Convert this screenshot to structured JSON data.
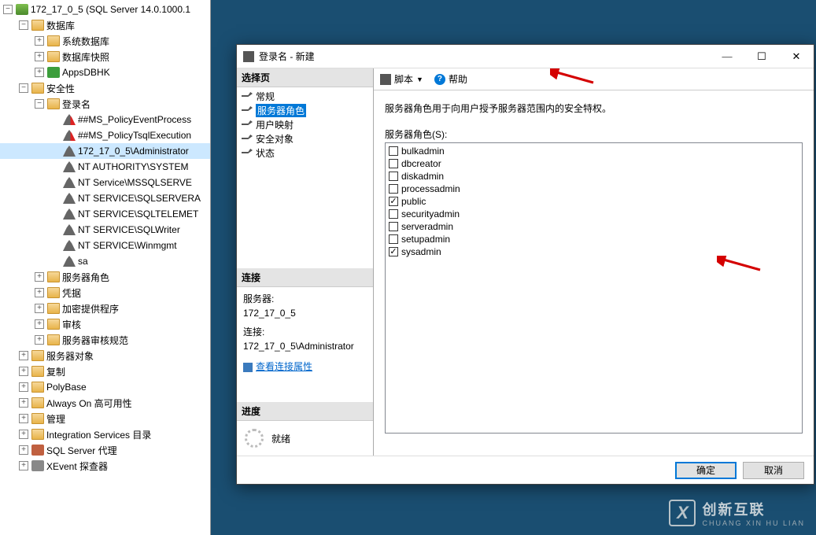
{
  "tree": {
    "server": "172_17_0_5 (SQL Server 14.0.1000.1",
    "db": "数据库",
    "sysdb": "系统数据库",
    "dbsnap": "数据库快照",
    "appsdb": "AppsDBHK",
    "security": "安全性",
    "logins": "登录名",
    "l1": "##MS_PolicyEventProcess",
    "l2": "##MS_PolicyTsqlExecution",
    "l3": "172_17_0_5\\Administrator",
    "l4": "NT AUTHORITY\\SYSTEM",
    "l5": "NT Service\\MSSQLSERVE",
    "l6": "NT SERVICE\\SQLSERVERA",
    "l7": "NT SERVICE\\SQLTELEMET",
    "l8": "NT SERVICE\\SQLWriter",
    "l9": "NT SERVICE\\Winmgmt",
    "l10": "sa",
    "srvroles": "服务器角色",
    "creds": "凭据",
    "crypto": "加密提供程序",
    "audit": "审核",
    "auditspec": "服务器审核规范",
    "srvobj": "服务器对象",
    "repl": "复制",
    "polybase": "PolyBase",
    "alwayson": "Always On 高可用性",
    "mgmt": "管理",
    "iscat": "Integration Services 目录",
    "agent": "SQL Server 代理",
    "xevent": "XEvent 探查器"
  },
  "dialog": {
    "title": "登录名 - 新建",
    "selectpage": "选择页",
    "pages": {
      "general": "常规",
      "serverroles": "服务器角色",
      "usermap": "用户映射",
      "securables": "安全对象",
      "status": "状态"
    },
    "connection_hdr": "连接",
    "server_lbl": "服务器:",
    "server_val": "172_17_0_5",
    "conn_lbl": "连接:",
    "conn_val": "172_17_0_5\\Administrator",
    "viewprops": "查看连接属性",
    "progress_hdr": "进度",
    "ready": "就绪",
    "script": "脚本",
    "help": "帮助",
    "desc": "服务器角色用于向用户授予服务器范围内的安全特权。",
    "roles_label": "服务器角色(S):",
    "roles": [
      {
        "name": "bulkadmin",
        "checked": false
      },
      {
        "name": "dbcreator",
        "checked": false
      },
      {
        "name": "diskadmin",
        "checked": false
      },
      {
        "name": "processadmin",
        "checked": false
      },
      {
        "name": "public",
        "checked": true
      },
      {
        "name": "securityadmin",
        "checked": false
      },
      {
        "name": "serveradmin",
        "checked": false
      },
      {
        "name": "setupadmin",
        "checked": false
      },
      {
        "name": "sysadmin",
        "checked": true
      }
    ],
    "ok": "确定",
    "cancel": "取消"
  },
  "watermark": {
    "big": "创新互联",
    "small": "CHUANG XIN HU LIAN"
  }
}
